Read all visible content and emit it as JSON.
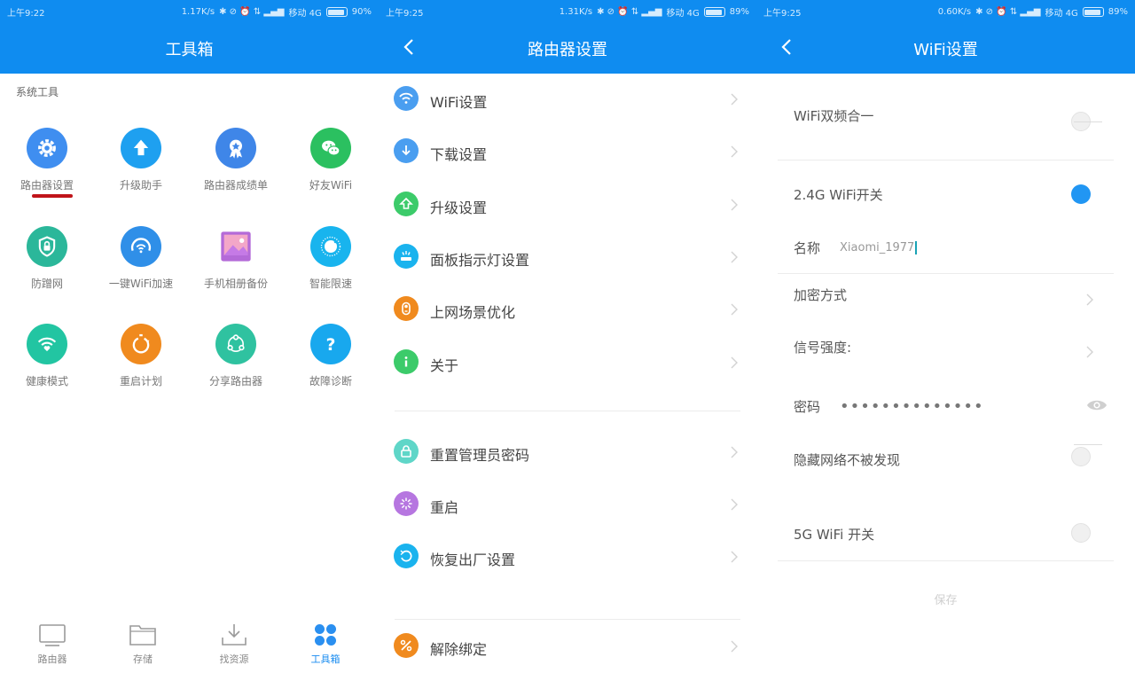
{
  "status_left": {
    "time": "上午9:22",
    "speed": "1.17K/s",
    "carrier": "移动 4G",
    "battery": "90%"
  },
  "status_mid": {
    "time": "上午9:25",
    "speed": "1.31K/s",
    "carrier": "移动 4G",
    "battery": "89%"
  },
  "status_right": {
    "time": "上午9:25",
    "speed": "0.60K/s",
    "carrier": "移动 4G",
    "battery": "89%"
  },
  "toolbox": {
    "title": "工具箱",
    "section": "系统工具",
    "tools": [
      {
        "label": "路由器设置",
        "icon": "gear-icon",
        "color": "#3f8ef0"
      },
      {
        "label": "升级助手",
        "icon": "upload-arrow-icon",
        "color": "#1ea0f0"
      },
      {
        "label": "路由器成绩单",
        "icon": "medal-icon",
        "color": "#3f86e8"
      },
      {
        "label": "好友WiFi",
        "icon": "wechat-icon",
        "color": "#2bc060"
      },
      {
        "label": "防蹭网",
        "icon": "shield-lock-icon",
        "color": "#2bb79a"
      },
      {
        "label": "一键WiFi加速",
        "icon": "speedometer-icon",
        "color": "#2f8fe8"
      },
      {
        "label": "手机相册备份",
        "icon": "photo-icon",
        "color": "#b46ad8"
      },
      {
        "label": "智能限速",
        "icon": "ring-icon",
        "color": "#18b4ee"
      },
      {
        "label": "健康模式",
        "icon": "wifi-heart-icon",
        "color": "#22c5a2"
      },
      {
        "label": "重启计划",
        "icon": "stopwatch-icon",
        "color": "#f08a1e"
      },
      {
        "label": "分享路由器",
        "icon": "share-icon",
        "color": "#2fc2a0"
      },
      {
        "label": "故障诊断",
        "icon": "question-icon",
        "color": "#18a8ee"
      }
    ],
    "nav": [
      {
        "label": "路由器",
        "icon": "monitor-icon"
      },
      {
        "label": "存储",
        "icon": "folder-icon"
      },
      {
        "label": "找资源",
        "icon": "download-tray-icon"
      },
      {
        "label": "工具箱",
        "icon": "grid-dots-icon"
      }
    ]
  },
  "router_settings": {
    "title": "路由器设置",
    "items": [
      {
        "label": "WiFi设置",
        "icon": "wifi-icon",
        "color": "#4a9ef0"
      },
      {
        "label": "下载设置",
        "icon": "download-icon",
        "color": "#4a9ef0"
      },
      {
        "label": "升级设置",
        "icon": "upgrade-icon",
        "color": "#3ccb6a"
      },
      {
        "label": "面板指示灯设置",
        "icon": "indicator-light-icon",
        "color": "#1ab3ee"
      },
      {
        "label": "上网场景优化",
        "icon": "scene-toggle-icon",
        "color": "#f08a1e"
      },
      {
        "label": "关于",
        "icon": "info-icon",
        "color": "#3ccb6a"
      },
      {
        "label": "重置管理员密码",
        "icon": "lock-icon",
        "color": "#5fd6c8"
      },
      {
        "label": "重启",
        "icon": "restart-icon",
        "color": "#b676e0"
      },
      {
        "label": "恢复出厂设置",
        "icon": "restore-icon",
        "color": "#1ab3ee"
      },
      {
        "label": "解除绑定",
        "icon": "unbind-icon",
        "color": "#f08a1e"
      }
    ]
  },
  "wifi_settings": {
    "title": "WiFi设置",
    "dual_band": {
      "label": "WiFi双频合一"
    },
    "g24_switch": {
      "label": "2.4G WiFi开关"
    },
    "name": {
      "label": "名称",
      "value": "Xiaomi_1977"
    },
    "encryption": {
      "label": "加密方式"
    },
    "signal": {
      "label": "信号强度:"
    },
    "password": {
      "label": "密码",
      "value": "••••••••••••••"
    },
    "hidden": {
      "label": "隐藏网络不被发现"
    },
    "g5_switch": {
      "label": "5G WiFi 开关"
    },
    "save_label": "保存"
  }
}
